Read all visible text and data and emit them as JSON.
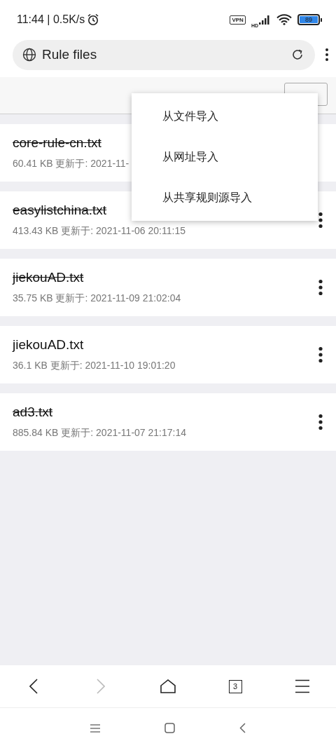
{
  "status_bar": {
    "time": "11:44 | 0.5K/s",
    "vpn": "VPN",
    "network": "HD",
    "battery": "89"
  },
  "address_bar": {
    "text": "Rule files"
  },
  "header": {
    "import_button": true
  },
  "files": [
    {
      "name": "core-rule-cn.txt",
      "info": "60.41 KB 更新于: 2021-11-",
      "enabled": false,
      "more_button": false
    },
    {
      "name": "easylistchina.txt",
      "info": "413.43 KB 更新于: 2021-11-06 20:11:15",
      "enabled": false,
      "more_button": true
    },
    {
      "name": "jiekouAD.txt",
      "info": "35.75 KB 更新于: 2021-11-09 21:02:04",
      "enabled": false,
      "more_button": true
    },
    {
      "name": "jiekouAD.txt",
      "info": "36.1 KB 更新于: 2021-11-10 19:01:20",
      "enabled": true,
      "more_button": true
    },
    {
      "name": "ad3.txt",
      "info": "885.84 KB 更新于: 2021-11-07 21:17:14",
      "enabled": false,
      "more_button": true
    }
  ],
  "import_menu": [
    "从文件导入",
    "从网址导入",
    "从共享规则源导入"
  ],
  "bottom_nav": [
    {
      "kind": "back",
      "disabled": false
    },
    {
      "kind": "forward",
      "disabled": true
    },
    {
      "kind": "home",
      "disabled": false
    },
    {
      "kind": "tabs",
      "label": "3",
      "disabled": false
    },
    {
      "kind": "menu",
      "disabled": false
    }
  ],
  "system_nav": [
    {
      "kind": "recents"
    },
    {
      "kind": "home"
    },
    {
      "kind": "back"
    }
  ]
}
